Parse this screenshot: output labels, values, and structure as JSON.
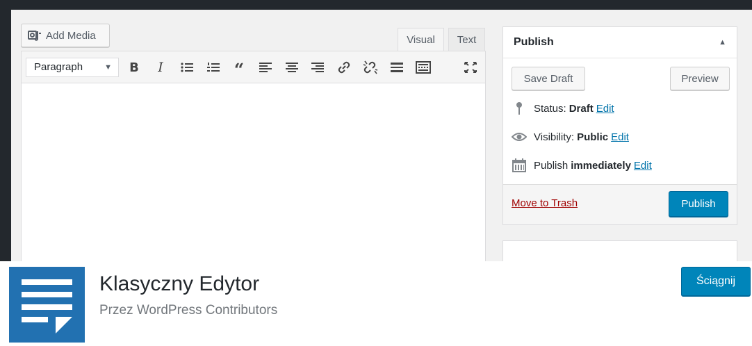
{
  "editor": {
    "add_media_label": "Add Media",
    "tabs": [
      {
        "label": "Visual"
      },
      {
        "label": "Text"
      }
    ],
    "format_select": "Paragraph",
    "toolbar_icons": [
      "bold-icon",
      "italic-icon",
      "bulleted-list-icon",
      "numbered-list-icon",
      "blockquote-icon",
      "align-left-icon",
      "align-center-icon",
      "align-right-icon",
      "insert-link-icon",
      "remove-link-icon",
      "read-more-icon",
      "toolbar-toggle-icon",
      "fullscreen-icon"
    ],
    "bold_glyph": "B",
    "italic_glyph": "I",
    "quote_glyph": "“"
  },
  "publish_box": {
    "title": "Publish",
    "save_draft_label": "Save Draft",
    "preview_label": "Preview",
    "status": {
      "label": "Status:",
      "value": "Draft",
      "edit": "Edit"
    },
    "visibility": {
      "label": "Visibility:",
      "value": "Public",
      "edit": "Edit"
    },
    "schedule": {
      "label": "Publish",
      "value": "immediately",
      "edit": "Edit"
    },
    "trash_label": "Move to Trash",
    "publish_label": "Publish"
  },
  "plugin": {
    "name": "Klasyczny Edytor",
    "author": "Przez WordPress Contributors",
    "download_label": "Ściągnij",
    "icon_color": "#2271b1"
  },
  "colors": {
    "accent": "#0085ba",
    "link": "#0073aa",
    "trash": "#a00000",
    "background": "#23282d"
  }
}
